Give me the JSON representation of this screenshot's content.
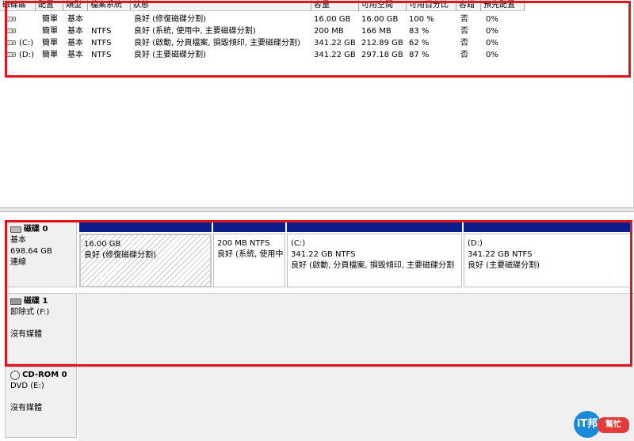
{
  "volumes": {
    "columns": [
      "磁碟區",
      "配置",
      "類型",
      "檔案系統",
      "狀態",
      "容量",
      "可用空間",
      "可用百分比",
      "容錯",
      "預先配置"
    ],
    "rows": [
      {
        "name": "",
        "layout": "簡單",
        "type": "基本",
        "fs": "",
        "status": "良好 (修復磁碟分割)",
        "capacity": "16.00 GB",
        "free": "16.00 GB",
        "pct": "100 %",
        "ft": "否",
        "overhead": "0%"
      },
      {
        "name": "",
        "layout": "簡單",
        "type": "基本",
        "fs": "NTFS",
        "status": "良好 (系統, 使用中, 主要磁碟分割)",
        "capacity": "200 MB",
        "free": "166 MB",
        "pct": "83 %",
        "ft": "否",
        "overhead": "0%"
      },
      {
        "name": "(C:)",
        "layout": "簡單",
        "type": "基本",
        "fs": "NTFS",
        "status": "良好 (啟動, 分頁檔案, 損毀傾印, 主要磁碟分割)",
        "capacity": "341.22 GB",
        "free": "212.89 GB",
        "pct": "62 %",
        "ft": "否",
        "overhead": "0%"
      },
      {
        "name": "(D:)",
        "layout": "簡單",
        "type": "基本",
        "fs": "NTFS",
        "status": "良好 (主要磁碟分割)",
        "capacity": "341.22 GB",
        "free": "297.18 GB",
        "pct": "87 %",
        "ft": "否",
        "overhead": "0%"
      }
    ]
  },
  "disks": [
    {
      "title": "磁碟 0",
      "line1": "基本",
      "line2": "698.64 GB",
      "line3": "連線",
      "partitions": [
        {
          "name": "",
          "size": "16.00 GB",
          "status": "良好 (修復磁碟分割)"
        },
        {
          "name": "",
          "size": "200 MB NTFS",
          "status": "良好 (系統, 使用中"
        },
        {
          "name": "(C:)",
          "size": "341.22 GB NTFS",
          "status": "良好 (啟動, 分頁檔案, 損毀傾印, 主要磁碟分割"
        },
        {
          "name": "(D:)",
          "size": "341.22 GB NTFS",
          "status": "良好 (主要磁碟分割)"
        }
      ]
    },
    {
      "title": "磁碟 1",
      "line1": "卸除式 (F:)",
      "line2": "",
      "line3": "沒有媒體"
    },
    {
      "title": "CD-ROM 0",
      "line1": "DVD (E:)",
      "line2": "",
      "line3": "沒有媒體"
    }
  ],
  "icons": {
    "hdd": "hard-disk-icon",
    "removable": "removable-disk-icon",
    "cdrom": "cdrom-icon",
    "volume": "volume-icon"
  },
  "colors": {
    "partition_bar": "#0b1e8a",
    "highlight": "#e0151c"
  },
  "watermark": {
    "logo": "iT邦",
    "text": "幫忙"
  }
}
